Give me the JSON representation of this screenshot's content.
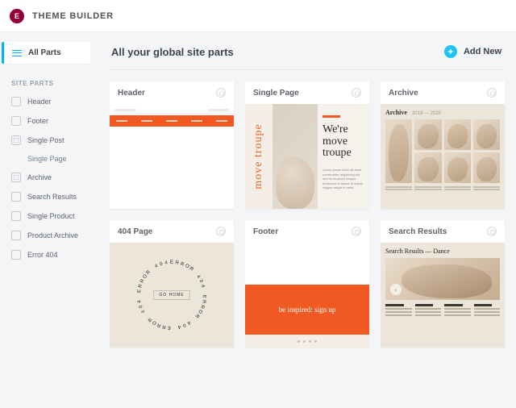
{
  "app": {
    "title": "THEME BUILDER",
    "logo_glyph": "E"
  },
  "sidebar": {
    "all_parts_label": "All Parts",
    "section_label": "SITE PARTS",
    "items": [
      {
        "label": "Header"
      },
      {
        "label": "Footer"
      },
      {
        "label": "Single Post",
        "children": [
          {
            "label": "Single Page"
          }
        ]
      },
      {
        "label": "Archive"
      },
      {
        "label": "Search Results"
      },
      {
        "label": "Single Product"
      },
      {
        "label": "Product Archive"
      },
      {
        "label": "Error 404"
      }
    ]
  },
  "main": {
    "title": "All your global site parts",
    "add_new_label": "Add New"
  },
  "cards": [
    {
      "title": "Header"
    },
    {
      "title": "Single Page",
      "headline": "We're move troupe",
      "side_text": "move troupe"
    },
    {
      "title": "Archive",
      "heading": "Archive",
      "range": "2019 — 2020"
    },
    {
      "title": "404 Page",
      "ring_text": "ERROR 404 ERROR 404 ERROR 404 ERROR 404",
      "center": "GO HOME"
    },
    {
      "title": "Footer",
      "cta": "be inspired: sign up"
    },
    {
      "title": "Search Results",
      "heading": "Search Results — Dance"
    }
  ]
}
